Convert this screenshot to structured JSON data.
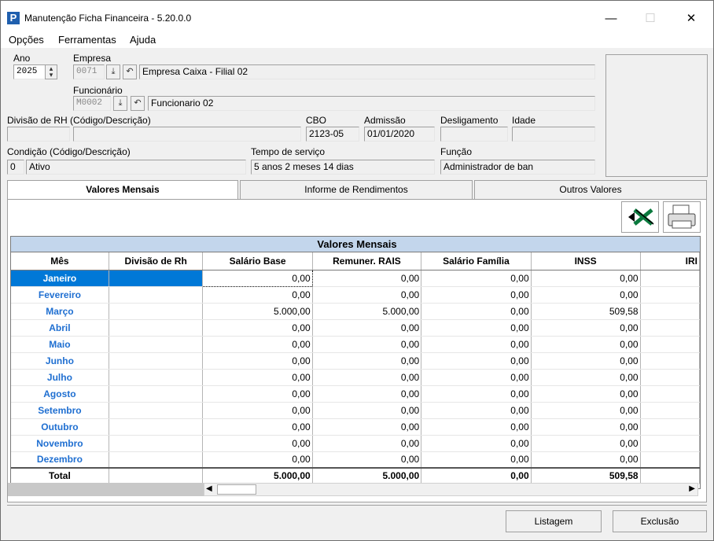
{
  "window": {
    "title": "Manutenção Ficha Financeira - 5.20.0.0",
    "app_icon": "P"
  },
  "window_controls": {
    "minimize": "—",
    "maximize": "☐",
    "close": "✕"
  },
  "menu": [
    "Opções",
    "Ferramentas",
    "Ajuda"
  ],
  "form": {
    "ano_label": "Ano",
    "ano_value": "2025",
    "empresa_label": "Empresa",
    "empresa_code": "0071",
    "empresa_name": "Empresa Caixa - Filial 02",
    "funcionario_label": "Funcionário",
    "funcionario_code": "M0002",
    "funcionario_name": "Funcionario 02",
    "divisao_label": "Divisão de RH (Código/Descrição)",
    "cbo_label": "CBO",
    "cbo_value": "2123-05",
    "admissao_label": "Admissão",
    "admissao_value": "01/01/2020",
    "desligamento_label": "Desligamento",
    "idade_label": "Idade",
    "condicao_label": "Condição (Código/Descrição)",
    "condicao_code": "0",
    "condicao_desc": "Ativo",
    "tempo_label": "Tempo de serviço",
    "tempo_value": "5 anos 2 meses 14 dias",
    "funcao_label": "Função",
    "funcao_value": "Administrador de ban"
  },
  "tabs": [
    "Valores Mensais",
    "Informe de Rendimentos",
    "Outros Valores"
  ],
  "grid": {
    "title": "Valores Mensais",
    "columns": [
      "Mês",
      "Divisão de Rh",
      "Salário Base",
      "Remuner. RAIS",
      "Salário Família",
      "INSS",
      "IRI"
    ],
    "rows": [
      {
        "mes": "Janeiro",
        "div": "",
        "sb": "0,00",
        "rais": "0,00",
        "sf": "0,00",
        "inss": "0,00"
      },
      {
        "mes": "Fevereiro",
        "div": "",
        "sb": "0,00",
        "rais": "0,00",
        "sf": "0,00",
        "inss": "0,00"
      },
      {
        "mes": "Março",
        "div": "",
        "sb": "5.000,00",
        "rais": "5.000,00",
        "sf": "0,00",
        "inss": "509,58"
      },
      {
        "mes": "Abril",
        "div": "",
        "sb": "0,00",
        "rais": "0,00",
        "sf": "0,00",
        "inss": "0,00"
      },
      {
        "mes": "Maio",
        "div": "",
        "sb": "0,00",
        "rais": "0,00",
        "sf": "0,00",
        "inss": "0,00"
      },
      {
        "mes": "Junho",
        "div": "",
        "sb": "0,00",
        "rais": "0,00",
        "sf": "0,00",
        "inss": "0,00"
      },
      {
        "mes": "Julho",
        "div": "",
        "sb": "0,00",
        "rais": "0,00",
        "sf": "0,00",
        "inss": "0,00"
      },
      {
        "mes": "Agosto",
        "div": "",
        "sb": "0,00",
        "rais": "0,00",
        "sf": "0,00",
        "inss": "0,00"
      },
      {
        "mes": "Setembro",
        "div": "",
        "sb": "0,00",
        "rais": "0,00",
        "sf": "0,00",
        "inss": "0,00"
      },
      {
        "mes": "Outubro",
        "div": "",
        "sb": "0,00",
        "rais": "0,00",
        "sf": "0,00",
        "inss": "0,00"
      },
      {
        "mes": "Novembro",
        "div": "",
        "sb": "0,00",
        "rais": "0,00",
        "sf": "0,00",
        "inss": "0,00"
      },
      {
        "mes": "Dezembro",
        "div": "",
        "sb": "0,00",
        "rais": "0,00",
        "sf": "0,00",
        "inss": "0,00"
      }
    ],
    "total": {
      "label": "Total",
      "sb": "5.000,00",
      "rais": "5.000,00",
      "sf": "0,00",
      "inss": "509,58"
    }
  },
  "buttons": {
    "listagem": "Listagem",
    "exclusao": "Exclusão"
  },
  "colors": {
    "selection": "#0078d7",
    "month_text": "#1f6fd1",
    "grid_title_bg": "#c3d6ec"
  }
}
